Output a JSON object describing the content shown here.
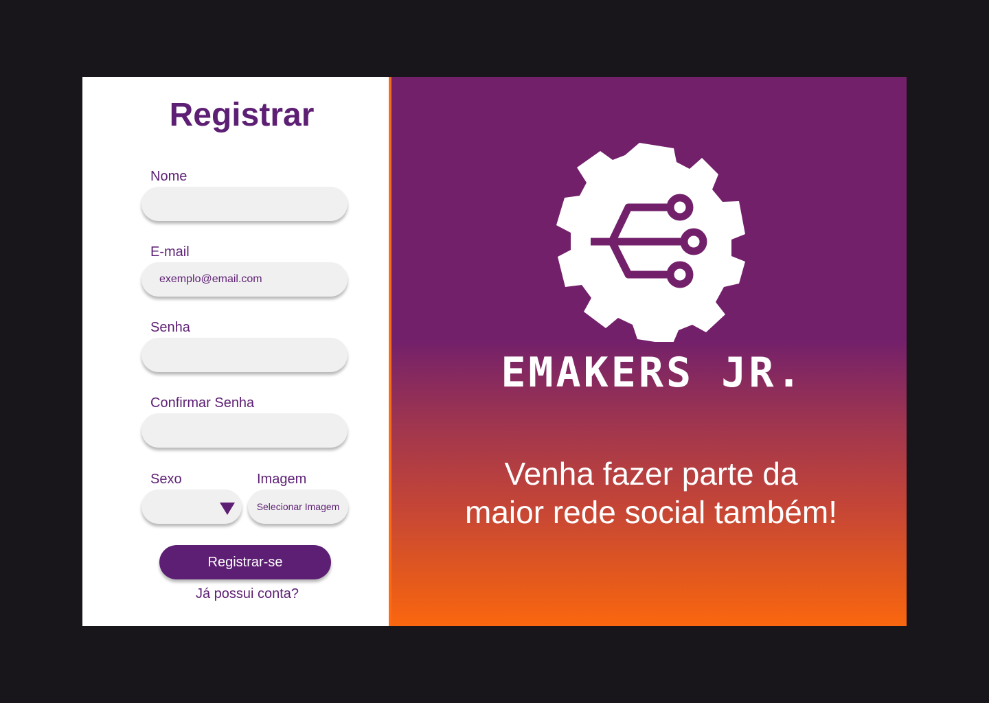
{
  "form": {
    "title": "Registrar",
    "fields": [
      {
        "label": "Nome",
        "value": ""
      },
      {
        "label": "E-mail",
        "value": "exemplo@email.com"
      },
      {
        "label": "Senha",
        "value": ""
      },
      {
        "label": "Confirmar Senha",
        "value": ""
      }
    ],
    "sexo_label": "Sexo",
    "imagem_label": "Imagem",
    "imagem_button": "Selecionar Imagem",
    "submit": "Registrar-se",
    "login_link": "Já possui conta?"
  },
  "brand": {
    "name": "EMAKERS JR.",
    "tagline_line1": "Venha fazer parte da",
    "tagline_line2": "maior rede social também!",
    "logo_icon": "gear-circuit-icon"
  },
  "colors": {
    "brand_purple": "#5d1f73",
    "panel_purple": "#73206b",
    "panel_orange": "#fb670f",
    "field_bg": "#f0f0f0"
  }
}
